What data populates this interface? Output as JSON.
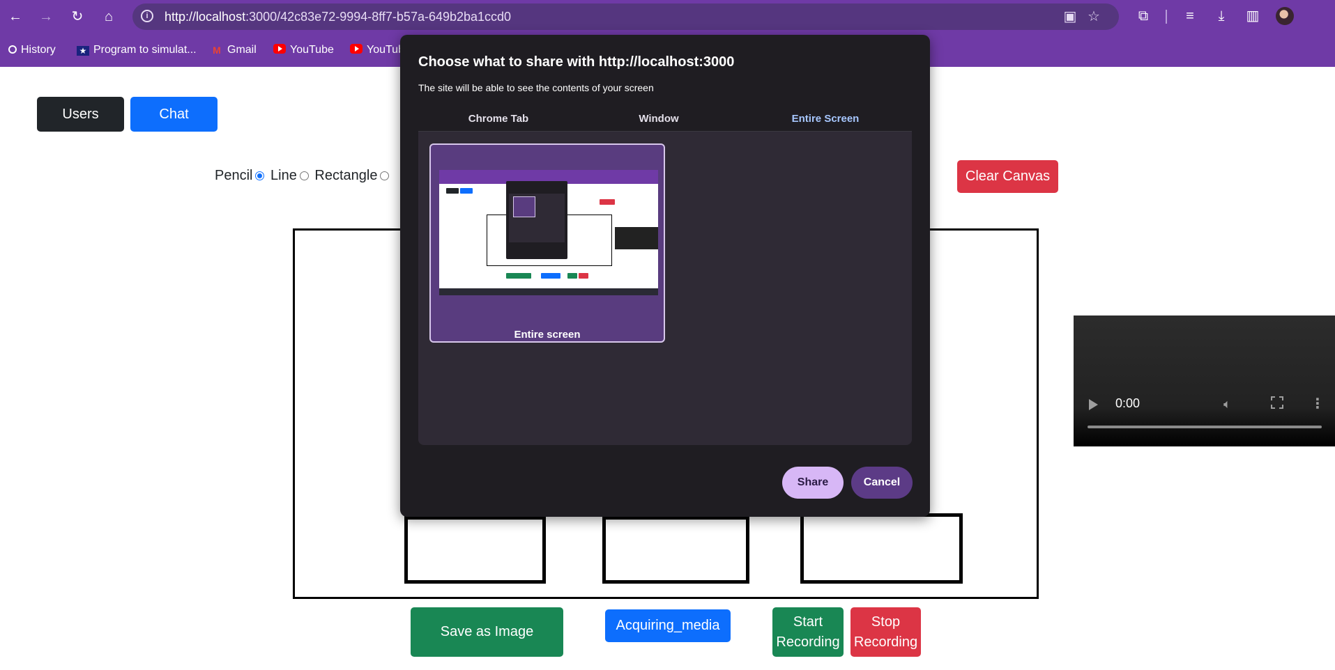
{
  "browser": {
    "url_base": "http://localhost",
    "url_rest": ":3000/42c83e72-9994-8ff7-b57a-649b2ba1ccd0",
    "bookmarks": [
      "History",
      "Program to simulat...",
      "Gmail",
      "YouTube",
      "YouTube"
    ],
    "accent_color": "#6f3aa6"
  },
  "page": {
    "users_button": "Users",
    "chat_button": "Chat",
    "tools": [
      {
        "label": "Pencil",
        "checked": true
      },
      {
        "label": "Line",
        "checked": false
      },
      {
        "label": "Rectangle",
        "checked": false
      }
    ],
    "clear_canvas": "Clear Canvas",
    "save_image": "Save as Image",
    "acquiring_media": "Acquiring_media",
    "start_recording_line1": "Start",
    "start_recording_line2": "Recording",
    "stop_recording_line1": "Stop",
    "stop_recording_line2": "Recording",
    "video_time": "0:00"
  },
  "dialog": {
    "title": "Choose what to share with http://localhost:3000",
    "subtitle": "The site will be able to see the contents of your screen",
    "tabs": [
      "Chrome Tab",
      "Window",
      "Entire Screen"
    ],
    "active_tab": "Entire Screen",
    "source_label": "Entire screen",
    "share_button": "Share",
    "cancel_button": "Cancel"
  }
}
